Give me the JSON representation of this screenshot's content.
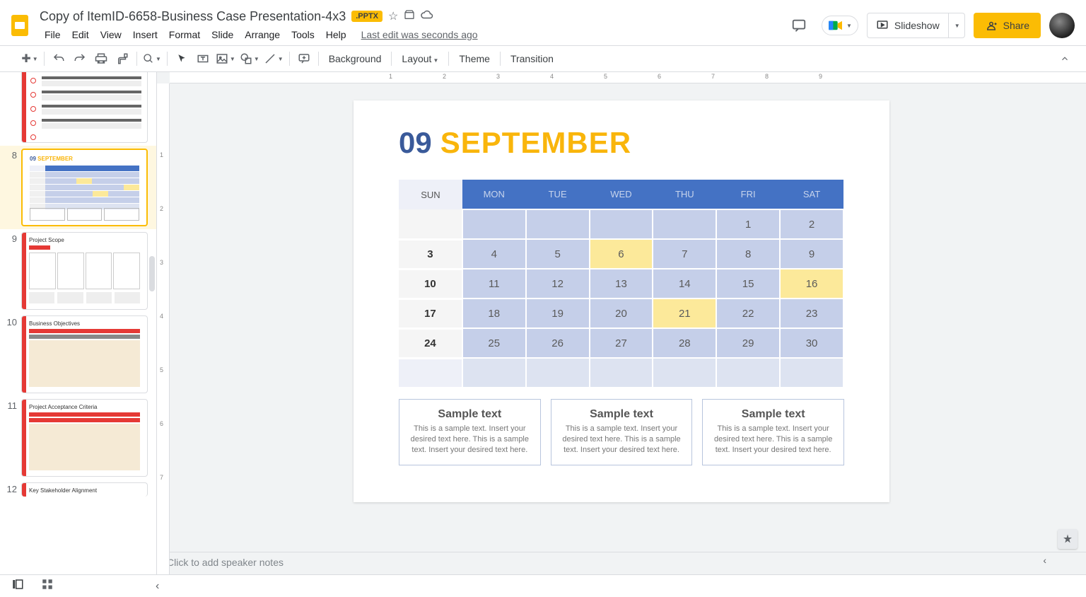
{
  "doc": {
    "title": "Copy of ItemID-6658-Business Case Presentation-4x3",
    "badge": ".PPTX",
    "last_edit": "Last edit was seconds ago"
  },
  "menus": [
    "File",
    "Edit",
    "View",
    "Insert",
    "Format",
    "Slide",
    "Arrange",
    "Tools",
    "Help"
  ],
  "header_buttons": {
    "slideshow": "Slideshow",
    "share": "Share"
  },
  "toolbar_text": {
    "background": "Background",
    "layout": "Layout",
    "theme": "Theme",
    "transition": "Transition"
  },
  "filmstrip": {
    "nums": [
      "8",
      "9",
      "10",
      "11",
      "12"
    ],
    "t9": "Project Scope",
    "t10": "Business Objectives",
    "t11": "Project Acceptance Criteria",
    "t12": "Key Stakeholder Alignment",
    "mini_num": "09",
    "mini_month": "SEPTEMBER"
  },
  "slide": {
    "num": "09",
    "month": "SEPTEMBER",
    "days": [
      "SUN",
      "MON",
      "TUE",
      "WED",
      "THU",
      "FRI",
      "SAT"
    ],
    "rows": [
      [
        {
          "v": "",
          "c": "sun"
        },
        {
          "v": "",
          "c": "wd"
        },
        {
          "v": "",
          "c": "wd"
        },
        {
          "v": "",
          "c": "wd"
        },
        {
          "v": "",
          "c": "wd"
        },
        {
          "v": "1",
          "c": "wd"
        },
        {
          "v": "2",
          "c": "wd"
        }
      ],
      [
        {
          "v": "3",
          "c": "sun"
        },
        {
          "v": "4",
          "c": "wd"
        },
        {
          "v": "5",
          "c": "wd"
        },
        {
          "v": "6",
          "c": "wd hl"
        },
        {
          "v": "7",
          "c": "wd"
        },
        {
          "v": "8",
          "c": "wd"
        },
        {
          "v": "9",
          "c": "wd"
        }
      ],
      [
        {
          "v": "10",
          "c": "sun"
        },
        {
          "v": "11",
          "c": "wd"
        },
        {
          "v": "12",
          "c": "wd"
        },
        {
          "v": "13",
          "c": "wd"
        },
        {
          "v": "14",
          "c": "wd"
        },
        {
          "v": "15",
          "c": "wd"
        },
        {
          "v": "16",
          "c": "wd hl"
        }
      ],
      [
        {
          "v": "17",
          "c": "sun"
        },
        {
          "v": "18",
          "c": "wd"
        },
        {
          "v": "19",
          "c": "wd"
        },
        {
          "v": "20",
          "c": "wd"
        },
        {
          "v": "21",
          "c": "wd hl"
        },
        {
          "v": "22",
          "c": "wd"
        },
        {
          "v": "23",
          "c": "wd"
        }
      ],
      [
        {
          "v": "24",
          "c": "sun"
        },
        {
          "v": "25",
          "c": "wd"
        },
        {
          "v": "26",
          "c": "wd"
        },
        {
          "v": "27",
          "c": "wd"
        },
        {
          "v": "28",
          "c": "wd"
        },
        {
          "v": "29",
          "c": "wd"
        },
        {
          "v": "30",
          "c": "wd"
        }
      ],
      [
        {
          "v": "",
          "c": "sun last"
        },
        {
          "v": "",
          "c": "wd last"
        },
        {
          "v": "",
          "c": "wd last"
        },
        {
          "v": "",
          "c": "wd last"
        },
        {
          "v": "",
          "c": "wd last"
        },
        {
          "v": "",
          "c": "wd last"
        },
        {
          "v": "",
          "c": "wd last"
        }
      ]
    ],
    "boxes": [
      {
        "title": "Sample text",
        "desc": "This is a sample text. Insert your desired text here. This is a sample text. Insert your desired text here."
      },
      {
        "title": "Sample text",
        "desc": "This is a sample text. Insert your desired text here. This is a sample text. Insert your desired text here."
      },
      {
        "title": "Sample text",
        "desc": "This is a sample text. Insert your desired text here. This is a sample text. Insert your desired text here."
      }
    ]
  },
  "notes": "Click to add speaker notes",
  "ruler_h": [
    "1",
    "2",
    "3",
    "4",
    "5",
    "6",
    "7",
    "8",
    "9"
  ],
  "ruler_v": [
    "1",
    "2",
    "3",
    "4",
    "5",
    "6",
    "7"
  ]
}
